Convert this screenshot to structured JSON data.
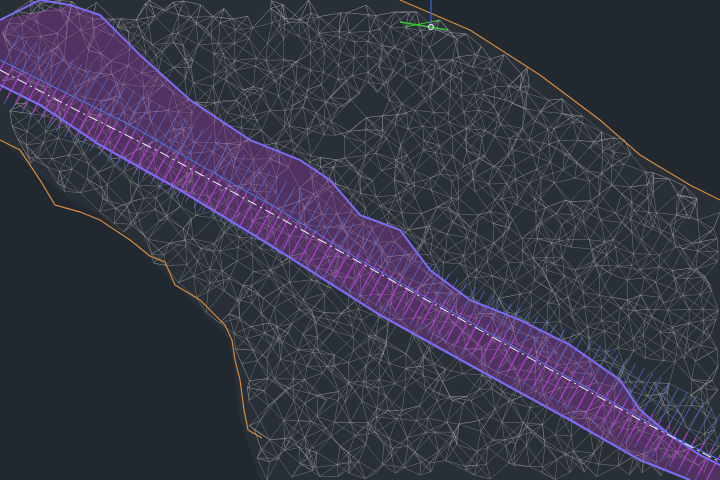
{
  "viewport": {
    "background_color": "#212830",
    "surface_wire_color": "#9c9c9c",
    "corridor_outline_color": "#7b6cf2",
    "corridor_section_color": "#4f74e6",
    "corridor_fill_color": "#b03cc7",
    "centerline_color": "#f0f0f0",
    "boundary_color": "#d98a3a",
    "ucs_x_color": "#39c739",
    "ucs_y_color": "#3b63e0",
    "ucs_origin_color": "#e0e0e0"
  },
  "ucs_icon": {
    "icon": "ucs-axis-icon"
  }
}
